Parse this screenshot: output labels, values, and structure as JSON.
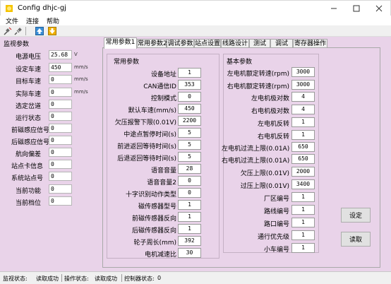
{
  "window": {
    "title": "Config dhjc-gj"
  },
  "menu": [
    "文件",
    "连接",
    "帮助"
  ],
  "monitor": {
    "title": "监视参数",
    "rows": [
      {
        "label": "电源电压",
        "value": "25.68",
        "unit": "V"
      },
      {
        "label": "设定车速",
        "value": "450",
        "unit": "mm/s"
      },
      {
        "label": "目标车速",
        "value": "0",
        "unit": "mm/s"
      },
      {
        "label": "实际车速",
        "value": "0",
        "unit": "mm/s"
      },
      {
        "label": "选定岔道",
        "value": "0",
        "unit": ""
      },
      {
        "label": "运行状态",
        "value": "0",
        "unit": ""
      },
      {
        "label": "前磁感应信号",
        "value": "0",
        "unit": ""
      },
      {
        "label": "后磁感应信号",
        "value": "0",
        "unit": ""
      },
      {
        "label": "航向偏差",
        "value": "0",
        "unit": ""
      },
      {
        "label": "站点卡信息",
        "value": "0",
        "unit": ""
      },
      {
        "label": "系统站点号",
        "value": "0",
        "unit": ""
      },
      {
        "label": "当前功能",
        "value": "0",
        "unit": ""
      },
      {
        "label": "当前档位",
        "value": "0",
        "unit": ""
      }
    ]
  },
  "tabs": [
    "常用参数1",
    "常用参数2",
    "调试参数",
    "站点设置",
    "线路设计",
    "测试",
    "调试",
    "寄存器操作"
  ],
  "common": {
    "title": "常用参数",
    "rows": [
      {
        "label": "设备地址",
        "value": "1"
      },
      {
        "label": "CAN通信ID",
        "value": "353"
      },
      {
        "label": "控制模式",
        "value": "0"
      },
      {
        "label": "默认车速(mm/s)",
        "value": "450"
      },
      {
        "label": "欠压报警下限(0.01V)",
        "value": "2200"
      },
      {
        "label": "中途点暂停时间(s)",
        "value": "5"
      },
      {
        "label": "前进返回等待时间(s)",
        "value": "5"
      },
      {
        "label": "后退返回等待时间(s)",
        "value": "5"
      },
      {
        "label": "语音音量",
        "value": "28"
      },
      {
        "label": "语音音量2",
        "value": "0"
      },
      {
        "label": "十字识别动作类型",
        "value": "0"
      },
      {
        "label": "磁传感器型号",
        "value": "1"
      },
      {
        "label": "前磁传感器反向",
        "value": "1"
      },
      {
        "label": "后磁传感器反向",
        "value": "1"
      },
      {
        "label": "轮子周长(mm)",
        "value": "392"
      },
      {
        "label": "电机减速比",
        "value": "30"
      }
    ]
  },
  "basic": {
    "title": "基本参数",
    "rows": [
      {
        "label": "左电机额定转速(rpm)",
        "value": "3000"
      },
      {
        "label": "右电机额定转速(rpm)",
        "value": "3000"
      },
      {
        "label": "左电机极对数",
        "value": "4"
      },
      {
        "label": "右电机极对数",
        "value": "4"
      },
      {
        "label": "左电机反转",
        "value": "1"
      },
      {
        "label": "右电机反转",
        "value": "1"
      },
      {
        "label": "左电机过流上限(0.01A)",
        "value": "650"
      },
      {
        "label": "右电机过流上限(0.01A)",
        "value": "650"
      },
      {
        "label": "欠压上限(0.01V)",
        "value": "2000"
      },
      {
        "label": "过压上限(0.01V)",
        "value": "3400"
      },
      {
        "label": "厂区编号",
        "value": "1"
      },
      {
        "label": "路线编号",
        "value": "1"
      },
      {
        "label": "路口编号",
        "value": "1"
      },
      {
        "label": "通行优先级",
        "value": "1"
      },
      {
        "label": "小车编号",
        "value": "1"
      }
    ]
  },
  "buttons": {
    "set": "设定",
    "read": "读取"
  },
  "status": [
    {
      "label": "监视状态:",
      "value": "读取成功"
    },
    {
      "label": "操作状态:",
      "value": "读取成功"
    },
    {
      "label": "控制器状态:",
      "value": "0"
    }
  ]
}
